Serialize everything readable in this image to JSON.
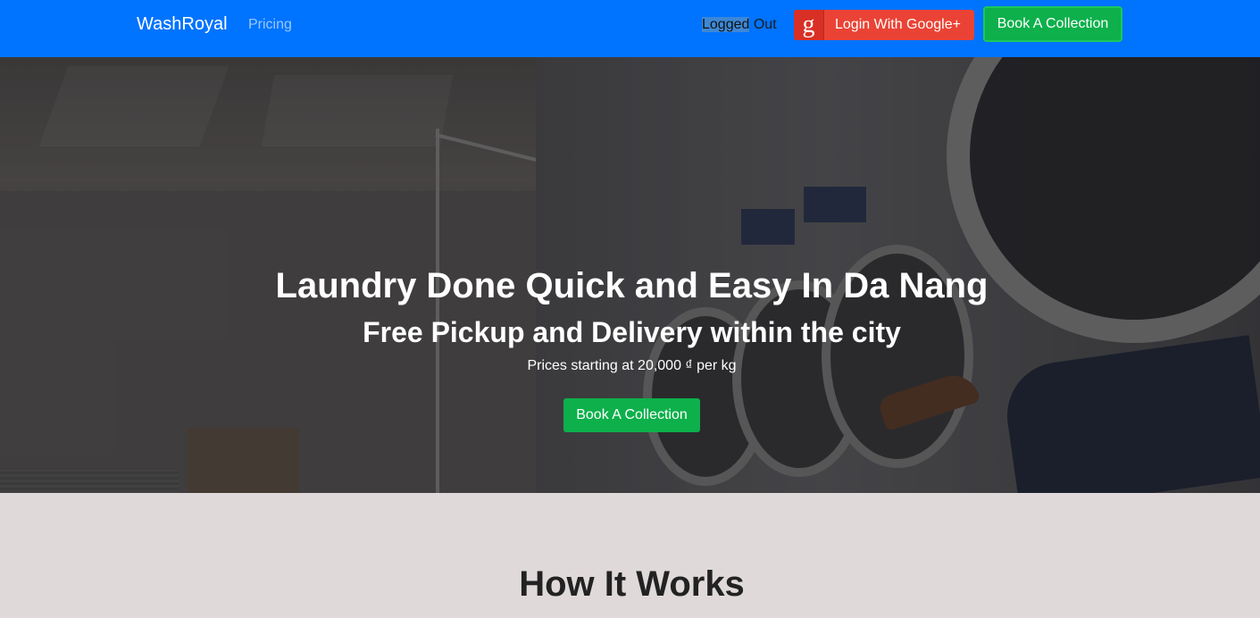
{
  "navbar": {
    "brand": "WashRoyal",
    "links": [
      {
        "label": "Pricing"
      }
    ],
    "status": {
      "highlighted": "Logged",
      "rest": " Out"
    },
    "google_button": {
      "icon": "google-g-icon",
      "glyph": "g",
      "label": "Login With Google+"
    },
    "cta_label": "Book A Collection"
  },
  "hero": {
    "title": "Laundry Done Quick and Easy In Da Nang",
    "subtitle": "Free Pickup and Delivery within the city",
    "price_line": "Prices starting at 20,000 ₫ per kg",
    "cta_label": "Book A Collection",
    "background_image": "laundromat-washing-machines-photo"
  },
  "how_it_works": {
    "title": "How It Works"
  },
  "colors": {
    "navbar": "#0073ff",
    "cta_green": "#0db04b",
    "google_red": "#ea4335",
    "section_bg": "#e0d9da"
  }
}
